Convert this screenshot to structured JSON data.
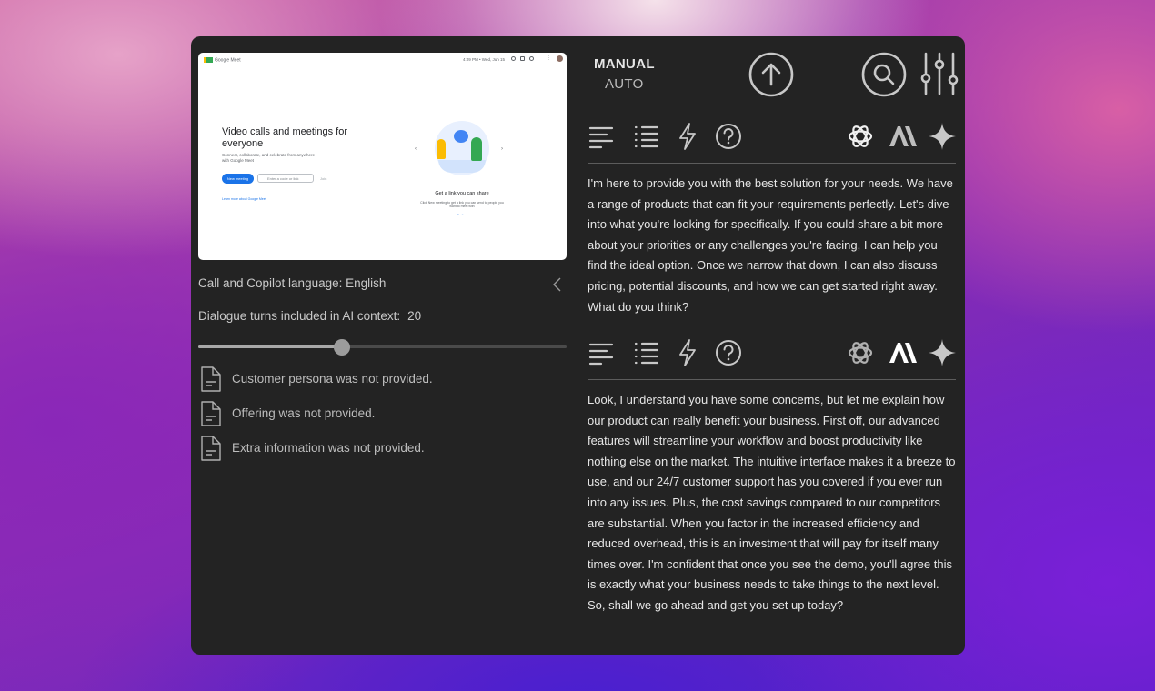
{
  "preview": {
    "app_name": "Google Meet",
    "time": "4:09 PM • Wed, Jun 15",
    "headline": "Video calls and meetings for everyone",
    "subtext": "Connect, collaborate, and celebrate from anywhere with Google Meet",
    "new_meeting": "New meeting",
    "code_placeholder": "Enter a code or link",
    "join": "Join",
    "learn_more": "Learn more about Google Meet",
    "caption": "Get a link you can share",
    "caption_detail": "Click New meeting to get a link you can send to people you want to meet with"
  },
  "settings": {
    "language_label": "Call and Copilot language:",
    "language_value": "English",
    "turns_label": "Dialogue turns included in AI context:",
    "turns_value": "20",
    "turns_fraction": 0.39,
    "info": [
      {
        "text": "Customer persona was not provided.",
        "icon": "document-icon"
      },
      {
        "text": "Offering was not provided.",
        "icon": "document-icon"
      },
      {
        "text": "Extra information was not provided.",
        "icon": "document-icon"
      }
    ]
  },
  "mode": {
    "manual": "MANUAL",
    "auto": "AUTO"
  },
  "toolbar_icons": [
    "upload-icon",
    "search-icon",
    "sliders-icon"
  ],
  "responses": [
    {
      "formats": [
        "paragraph-icon",
        "list-icon",
        "lightning-icon",
        "question-icon"
      ],
      "models": [
        "openai-icon",
        "anthropic-icon",
        "gemini-sparkle-icon"
      ],
      "active_model": "openai",
      "text": "I'm here to provide you with the best solution for your needs. We have a range of products that can fit your requirements perfectly. Let's dive into what you're looking for specifically. If you could share a bit more about your priorities or any challenges you're facing, I can help you find the ideal option. Once we narrow that down, I can also discuss pricing, potential discounts, and how we can get started right away. What do you think?"
    },
    {
      "formats": [
        "paragraph-icon",
        "list-icon",
        "lightning-icon",
        "question-icon"
      ],
      "models": [
        "openai-icon",
        "anthropic-icon",
        "gemini-sparkle-icon"
      ],
      "active_model": "anthropic",
      "text": "Look, I understand you have some concerns, but let me explain how our product can really benefit your business. First off, our advanced features will streamline your workflow and boost productivity like nothing else on the market. The intuitive interface makes it a breeze to use, and our 24/7 customer support has you covered if you ever run into any issues. Plus, the cost savings compared to our competitors are substantial. When you factor in the increased efficiency and reduced overhead, this is an investment that will pay for itself many times over. I'm confident that once you see the demo, you'll agree this is exactly what your business needs to take things to the next level. So, shall we go ahead and get you set up today?"
    }
  ],
  "colors": {
    "panel_bg": "#232323",
    "text": "#e6e6e6",
    "muted": "#bdbdbd",
    "icon": "#c8c8c8"
  }
}
